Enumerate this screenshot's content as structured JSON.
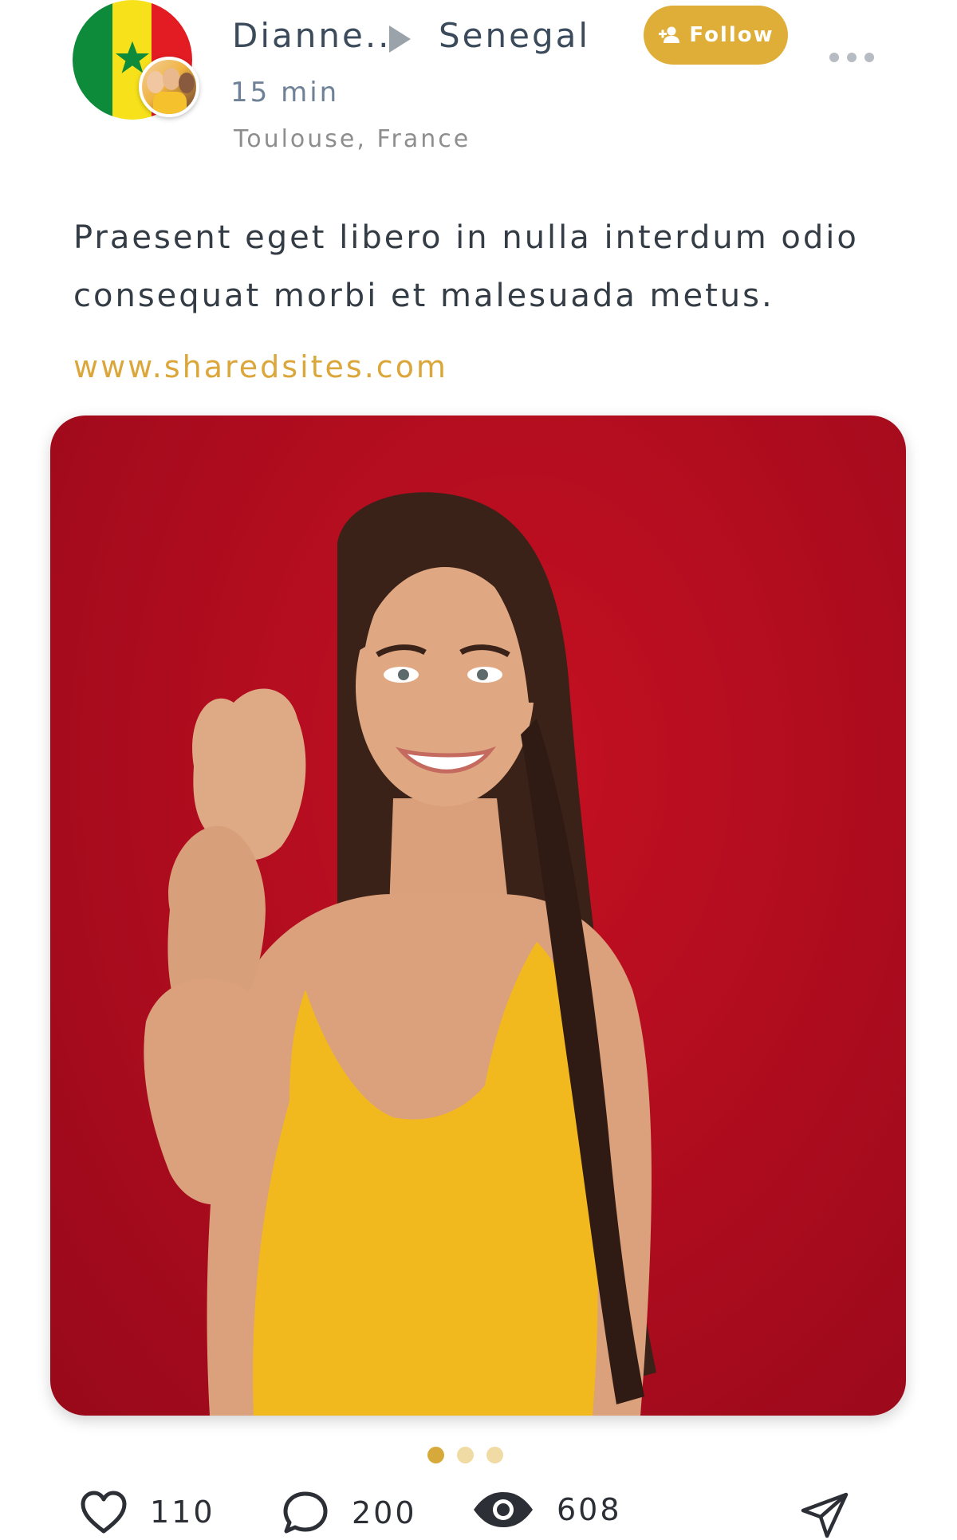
{
  "post": {
    "author": "Dianne..",
    "country": "Senegal",
    "time": "15 min",
    "location": "Toulouse, France",
    "follow_label": "Follow",
    "caption": "Praesent eget libero in nulla interdum odio consequat morbi et malesuada metus.",
    "link": "www.sharedsites.com"
  },
  "carousel": {
    "slides": 3,
    "active_index": 0
  },
  "actions": {
    "likes": "110",
    "comments": "200",
    "views": "608"
  },
  "icons": {
    "flag": "senegal-flag-icon",
    "arrow": "play-arrow-icon",
    "follow": "add-user-icon",
    "more": "more-dots-icon",
    "like": "heart-icon",
    "comment": "comment-icon",
    "views": "eye-icon",
    "share": "send-icon"
  },
  "colors": {
    "accent": "#dfae38",
    "link": "#dba63a",
    "dot_active": "#d7a93b",
    "dot_inactive": "#efdba3",
    "photo_bg": "#b10d1f"
  }
}
